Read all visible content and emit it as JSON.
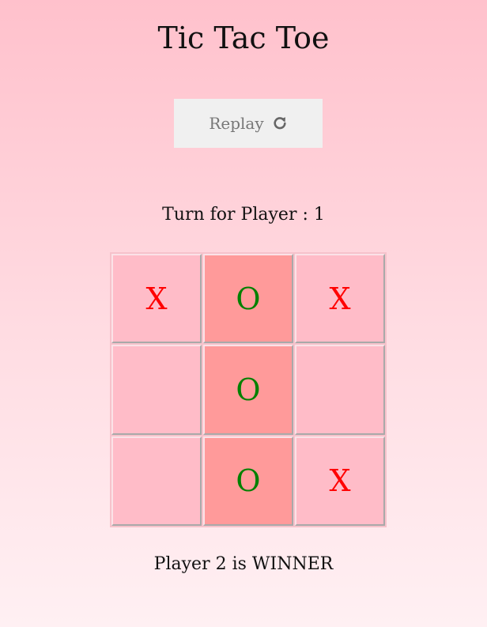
{
  "title": "Tic Tac Toe",
  "replay_button": {
    "label": "Replay",
    "icon": "redo-icon"
  },
  "turn_text": "Turn for Player : 1",
  "board": {
    "cells": [
      "X",
      "O",
      "X",
      "",
      "O",
      "",
      "",
      "O",
      "X"
    ],
    "winning_cells": [
      1,
      4,
      7
    ]
  },
  "result_text": "Player 2 is WINNER",
  "colors": {
    "x_mark": "#ff0000",
    "o_mark": "#008000",
    "cell_background": "#ffbcc8",
    "winning_cell_background": "#ff9a9a",
    "replay_button_background": "#f0f0f0"
  }
}
